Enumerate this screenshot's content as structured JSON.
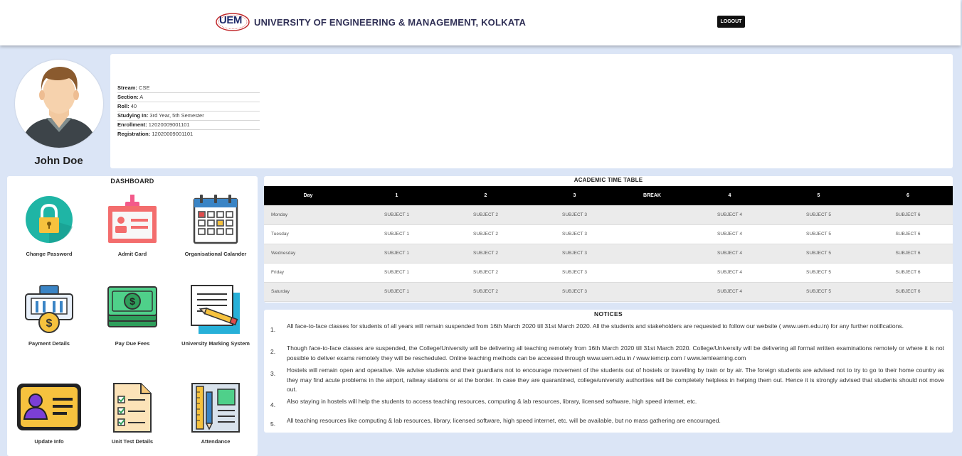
{
  "header": {
    "logo_text": "UEM",
    "title": "UNIVERSITY OF ENGINEERING & MANAGEMENT, KOLKATA",
    "logout_label": "LOGOUT"
  },
  "profile": {
    "name": "John Doe",
    "fields": [
      {
        "label": "Stream:",
        "value": "CSE"
      },
      {
        "label": "Section:",
        "value": "A"
      },
      {
        "label": "Roll:",
        "value": "40"
      },
      {
        "label": "Studying In:",
        "value": "3rd Year, 5th Semester"
      },
      {
        "label": "Enrollment:",
        "value": "12020009001101"
      },
      {
        "label": "Registration:",
        "value": "12020009001101"
      }
    ]
  },
  "dashboard": {
    "title": "DASHBOARD",
    "tiles": [
      {
        "label": "Change Password",
        "icon": "lock-icon"
      },
      {
        "label": "Admit Card",
        "icon": "id-card-icon"
      },
      {
        "label": "Organisational Calander",
        "icon": "calendar-icon"
      },
      {
        "label": "Payment Details",
        "icon": "payment-icon"
      },
      {
        "label": "Pay Due Fees",
        "icon": "cash-icon"
      },
      {
        "label": "University Marking System",
        "icon": "document-pencil-icon"
      },
      {
        "label": "Update Info",
        "icon": "user-card-icon"
      },
      {
        "label": "Unit Test Details",
        "icon": "checklist-icon"
      },
      {
        "label": "Attendance",
        "icon": "ruler-pencil-icon"
      }
    ]
  },
  "timetable": {
    "title": "ACADEMIC TIME TABLE",
    "headers": [
      "Day",
      "1",
      "2",
      "3",
      "BREAK",
      "4",
      "5",
      "6"
    ],
    "rows": [
      [
        "Monday",
        "SUBJECT 1",
        "SUBJECT 2",
        "SUBJECT 3",
        "",
        "SUBJECT 4",
        "SUBJECT 5",
        "SUBJECT 6"
      ],
      [
        "Tuesday",
        "SUBJECT 1",
        "SUBJECT 2",
        "SUBJECT 3",
        "",
        "SUBJECT 4",
        "SUBJECT 5",
        "SUBJECT 6"
      ],
      [
        "Wednesday",
        "SUBJECT 1",
        "SUBJECT 2",
        "SUBJECT 3",
        "",
        "SUBJECT 4",
        "SUBJECT 5",
        "SUBJECT 6"
      ],
      [
        "Friday",
        "SUBJECT 1",
        "SUBJECT 2",
        "SUBJECT 3",
        "",
        "SUBJECT 4",
        "SUBJECT 5",
        "SUBJECT 6"
      ],
      [
        "Saturday",
        "SUBJECT 1",
        "SUBJECT 2",
        "SUBJECT 3",
        "",
        "SUBJECT 4",
        "SUBJECT 5",
        "SUBJECT 6"
      ]
    ]
  },
  "notices": {
    "title": "NOTICES",
    "items": [
      {
        "num": "1.",
        "text": "All face-to-face classes for students of all years will remain suspended from 16th March 2020 till 31st March 2020. All the students and stakeholders are requested to follow our website ( www.uem.edu.in) for any further notifications."
      },
      {
        "num": "2.",
        "text": "Though face-to-face classes are suspended, the College/University will be delivering all teaching remotely from 16th March 2020 till 31st March 2020. College/University will be delivering all formal written examinations remotely or where it is not possible to deliver exams remotely they will be rescheduled. Online teaching methods can be accessed through www.uem.edu.in / www.iemcrp.com / www.iemlearning.com"
      },
      {
        "num": "3.",
        "text": "Hostels will remain open and operative. We advise students and their guardians not to encourage movement of the students out of hostels or travelling by train or by air. The foreign students are advised not to try to go to their home country as they may find acute problems in the airport, railway stations or at the border. In case they are quarantined, college/university authorities will be completely helpless in helping them out. Hence it is strongly advised that students should not move out."
      },
      {
        "num": "4.",
        "text": "Also staying in hostels will help the students to access teaching resources, computing & lab resources, library, licensed software, high speed internet, etc."
      },
      {
        "num": "5.",
        "text": "All teaching resources like computing & lab resources, library, licensed software, high speed internet, etc. will be available, but no mass gathering are encouraged."
      }
    ]
  }
}
